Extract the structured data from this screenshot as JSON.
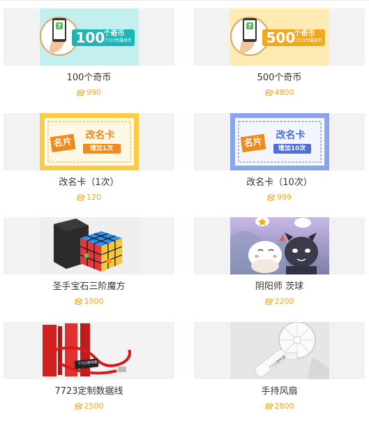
{
  "products": [
    {
      "title": "100个奇币",
      "price": "990",
      "art": "coins-100",
      "banner_amount": "100",
      "banner_unit": "个奇币",
      "banner_sub": "7723专属奇币"
    },
    {
      "title": "500个奇币",
      "price": "4800",
      "art": "coins-500",
      "banner_amount": "500",
      "banner_unit": "个奇币",
      "banner_sub": "7723专属奇币"
    },
    {
      "title": "改名卡（1次）",
      "price": "120",
      "art": "rename-1",
      "card_tag": "名片",
      "card_title": "改名卡",
      "card_sub": "增加1次"
    },
    {
      "title": "改名卡（10次）",
      "price": "999",
      "art": "rename-10",
      "card_tag": "名片",
      "card_title": "改名卡",
      "card_sub": "增加10次"
    },
    {
      "title": "圣手宝石三阶魔方",
      "price": "1900",
      "art": "rubik-cube"
    },
    {
      "title": "阴阳师 茨球",
      "price": "2200",
      "art": "plush-figures"
    },
    {
      "title": "7723定制数据线",
      "price": "2500",
      "art": "data-cable",
      "logo_text": "7723游戏盒"
    },
    {
      "title": "手持风扇",
      "price": "2800",
      "art": "handheld-fan",
      "logo_text": "7723游戏盒"
    }
  ],
  "colors": {
    "price": "#f2a91c",
    "title": "#333333",
    "thumb_bg": "#f2f2f2",
    "mint": "#c3f0ee",
    "cream": "#fdebb3",
    "rename_yellow": "#f9cc44",
    "rename_blue": "#8aa4f2"
  },
  "icons": {
    "price": "coin-stack-icon"
  }
}
